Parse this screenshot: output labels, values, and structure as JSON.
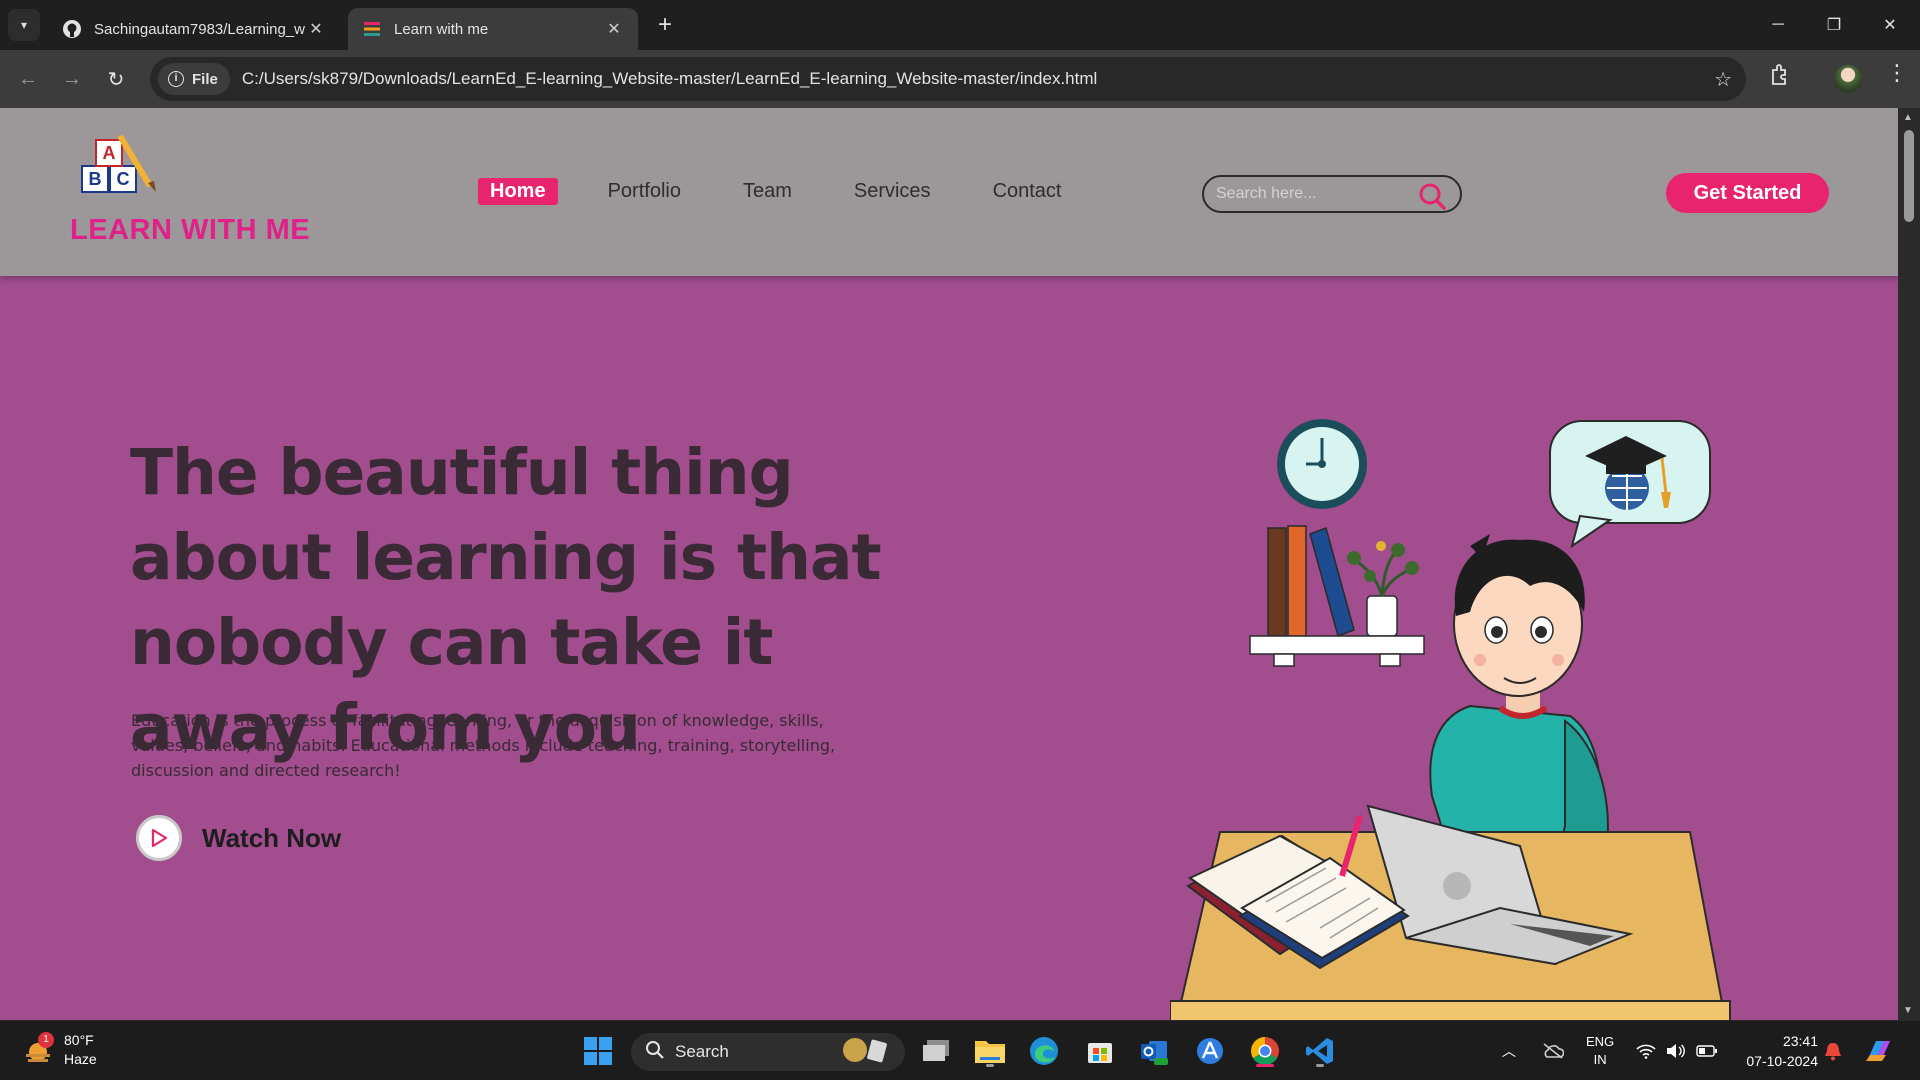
{
  "browser": {
    "tabs": [
      {
        "title": "Sachingautam7983/Learning_w",
        "active": false
      },
      {
        "title": "Learn with me",
        "active": true
      }
    ],
    "new_tab": "+",
    "address_chip": "File",
    "url": "C:/Users/sk879/Downloads/LearnEd_E-learning_Website-master/LearnEd_E-learning_Website-master/index.html",
    "window_controls": [
      "minimize-icon",
      "restore-icon",
      "close-icon"
    ]
  },
  "site": {
    "logo_text": "LEARN WITH ME",
    "nav": [
      {
        "label": "Home",
        "active": true
      },
      {
        "label": "Portfolio",
        "active": false
      },
      {
        "label": "Team",
        "active": false
      },
      {
        "label": "Services",
        "active": false
      },
      {
        "label": "Contact",
        "active": false
      }
    ],
    "search_placeholder": "Search here...",
    "cta_label": "Get Started",
    "hero": {
      "title": "The beautiful thing about learning is that nobody can take it away from you",
      "text": "Education is the process of facilitating learning, or the acquisition of knowledge, skills, values, beliefs, and habits. Educational methods include teaching, training, storytelling, discussion and directed research!",
      "watch_label": "Watch Now"
    },
    "colors": {
      "accent": "#e8246e",
      "header_bg": "#9c9799",
      "hero_bg": "#a14d8e",
      "logo": "#e0218a"
    }
  },
  "taskbar": {
    "weather": {
      "temp": "80°F",
      "condition": "Haze",
      "badge": "1"
    },
    "search_label": "Search",
    "apps": [
      "windows-start-icon",
      "task-view-icon",
      "file-explorer-icon",
      "edge-icon",
      "store-icon",
      "outlook-icon",
      "app-icon",
      "chrome-icon",
      "vscode-icon"
    ],
    "lang": {
      "line1": "ENG",
      "line2": "IN"
    },
    "time": "23:41",
    "date": "07-10-2024"
  }
}
